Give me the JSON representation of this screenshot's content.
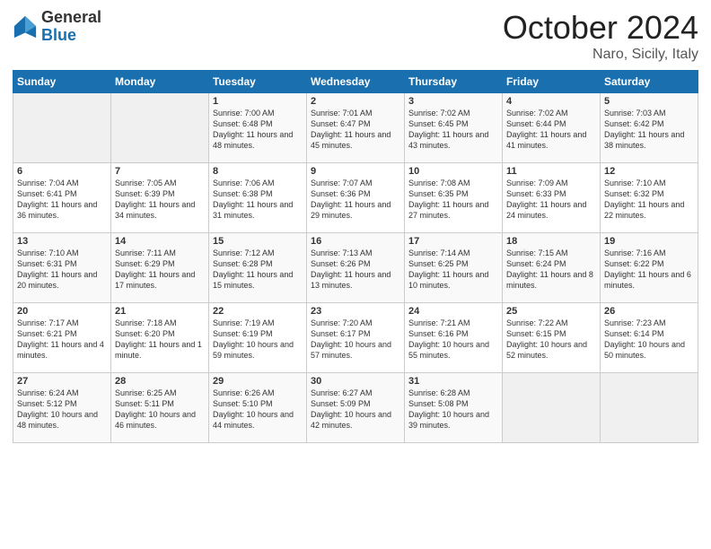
{
  "logo": {
    "general": "General",
    "blue": "Blue"
  },
  "title": "October 2024",
  "location": "Naro, Sicily, Italy",
  "headers": [
    "Sunday",
    "Monday",
    "Tuesday",
    "Wednesday",
    "Thursday",
    "Friday",
    "Saturday"
  ],
  "weeks": [
    [
      {
        "day": "",
        "info": ""
      },
      {
        "day": "",
        "info": ""
      },
      {
        "day": "1",
        "info": "Sunrise: 7:00 AM\nSunset: 6:48 PM\nDaylight: 11 hours and 48 minutes."
      },
      {
        "day": "2",
        "info": "Sunrise: 7:01 AM\nSunset: 6:47 PM\nDaylight: 11 hours and 45 minutes."
      },
      {
        "day": "3",
        "info": "Sunrise: 7:02 AM\nSunset: 6:45 PM\nDaylight: 11 hours and 43 minutes."
      },
      {
        "day": "4",
        "info": "Sunrise: 7:02 AM\nSunset: 6:44 PM\nDaylight: 11 hours and 41 minutes."
      },
      {
        "day": "5",
        "info": "Sunrise: 7:03 AM\nSunset: 6:42 PM\nDaylight: 11 hours and 38 minutes."
      }
    ],
    [
      {
        "day": "6",
        "info": "Sunrise: 7:04 AM\nSunset: 6:41 PM\nDaylight: 11 hours and 36 minutes."
      },
      {
        "day": "7",
        "info": "Sunrise: 7:05 AM\nSunset: 6:39 PM\nDaylight: 11 hours and 34 minutes."
      },
      {
        "day": "8",
        "info": "Sunrise: 7:06 AM\nSunset: 6:38 PM\nDaylight: 11 hours and 31 minutes."
      },
      {
        "day": "9",
        "info": "Sunrise: 7:07 AM\nSunset: 6:36 PM\nDaylight: 11 hours and 29 minutes."
      },
      {
        "day": "10",
        "info": "Sunrise: 7:08 AM\nSunset: 6:35 PM\nDaylight: 11 hours and 27 minutes."
      },
      {
        "day": "11",
        "info": "Sunrise: 7:09 AM\nSunset: 6:33 PM\nDaylight: 11 hours and 24 minutes."
      },
      {
        "day": "12",
        "info": "Sunrise: 7:10 AM\nSunset: 6:32 PM\nDaylight: 11 hours and 22 minutes."
      }
    ],
    [
      {
        "day": "13",
        "info": "Sunrise: 7:10 AM\nSunset: 6:31 PM\nDaylight: 11 hours and 20 minutes."
      },
      {
        "day": "14",
        "info": "Sunrise: 7:11 AM\nSunset: 6:29 PM\nDaylight: 11 hours and 17 minutes."
      },
      {
        "day": "15",
        "info": "Sunrise: 7:12 AM\nSunset: 6:28 PM\nDaylight: 11 hours and 15 minutes."
      },
      {
        "day": "16",
        "info": "Sunrise: 7:13 AM\nSunset: 6:26 PM\nDaylight: 11 hours and 13 minutes."
      },
      {
        "day": "17",
        "info": "Sunrise: 7:14 AM\nSunset: 6:25 PM\nDaylight: 11 hours and 10 minutes."
      },
      {
        "day": "18",
        "info": "Sunrise: 7:15 AM\nSunset: 6:24 PM\nDaylight: 11 hours and 8 minutes."
      },
      {
        "day": "19",
        "info": "Sunrise: 7:16 AM\nSunset: 6:22 PM\nDaylight: 11 hours and 6 minutes."
      }
    ],
    [
      {
        "day": "20",
        "info": "Sunrise: 7:17 AM\nSunset: 6:21 PM\nDaylight: 11 hours and 4 minutes."
      },
      {
        "day": "21",
        "info": "Sunrise: 7:18 AM\nSunset: 6:20 PM\nDaylight: 11 hours and 1 minute."
      },
      {
        "day": "22",
        "info": "Sunrise: 7:19 AM\nSunset: 6:19 PM\nDaylight: 10 hours and 59 minutes."
      },
      {
        "day": "23",
        "info": "Sunrise: 7:20 AM\nSunset: 6:17 PM\nDaylight: 10 hours and 57 minutes."
      },
      {
        "day": "24",
        "info": "Sunrise: 7:21 AM\nSunset: 6:16 PM\nDaylight: 10 hours and 55 minutes."
      },
      {
        "day": "25",
        "info": "Sunrise: 7:22 AM\nSunset: 6:15 PM\nDaylight: 10 hours and 52 minutes."
      },
      {
        "day": "26",
        "info": "Sunrise: 7:23 AM\nSunset: 6:14 PM\nDaylight: 10 hours and 50 minutes."
      }
    ],
    [
      {
        "day": "27",
        "info": "Sunrise: 6:24 AM\nSunset: 5:12 PM\nDaylight: 10 hours and 48 minutes."
      },
      {
        "day": "28",
        "info": "Sunrise: 6:25 AM\nSunset: 5:11 PM\nDaylight: 10 hours and 46 minutes."
      },
      {
        "day": "29",
        "info": "Sunrise: 6:26 AM\nSunset: 5:10 PM\nDaylight: 10 hours and 44 minutes."
      },
      {
        "day": "30",
        "info": "Sunrise: 6:27 AM\nSunset: 5:09 PM\nDaylight: 10 hours and 42 minutes."
      },
      {
        "day": "31",
        "info": "Sunrise: 6:28 AM\nSunset: 5:08 PM\nDaylight: 10 hours and 39 minutes."
      },
      {
        "day": "",
        "info": ""
      },
      {
        "day": "",
        "info": ""
      }
    ]
  ]
}
